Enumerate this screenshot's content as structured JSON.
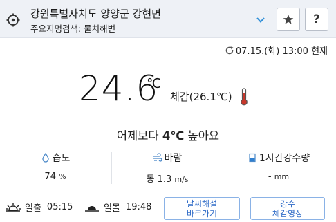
{
  "location": {
    "main": "강원특별자치도 양양군 강현면",
    "sub": "주요지명검색: 물치해변"
  },
  "header_icons": {
    "location": "crosshair-icon",
    "dropdown": "chevron-down-icon",
    "favorite": "star-icon",
    "help": "?"
  },
  "updated": "07.15.(화) 13:00 현재",
  "temperature": {
    "value": "24.6",
    "unit": "℃",
    "feels": "체감(26.1℃)"
  },
  "comparison": {
    "prefix": "어제보다 ",
    "delta": "4℃",
    "suffix": " 높아요"
  },
  "stats": {
    "humidity": {
      "label": "습도",
      "value": "74",
      "unit": "%"
    },
    "wind": {
      "label": "바람",
      "value": "동 1.3",
      "unit": "m/s"
    },
    "rain": {
      "label": "1시간강수량",
      "value": "-",
      "unit": "mm"
    }
  },
  "sun": {
    "sunrise_label": "일출",
    "sunrise_time": "05:15",
    "sunset_label": "일몰",
    "sunset_time": "19:48"
  },
  "buttons": {
    "history_line1": "날씨해설",
    "history_line2": "바로가기",
    "rain_line1": "강수",
    "rain_line2": "체감영상"
  },
  "colors": {
    "header_bg": "#eef1f6",
    "accent_blue": "#2f6bc7",
    "button_border": "#8ab2e6",
    "thermometer_red": "#c8382c"
  }
}
